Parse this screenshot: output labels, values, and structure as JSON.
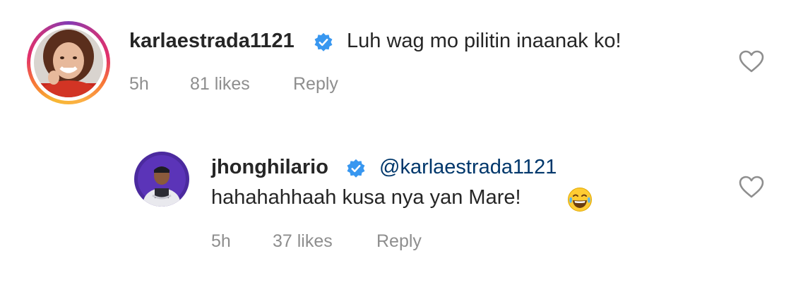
{
  "comments": [
    {
      "username": "karlaestrada1121",
      "verified": true,
      "text": "Luh wag mo pilitin inaanak ko!",
      "time": "5h",
      "likes": "81 likes",
      "reply_label": "Reply",
      "avatar_ring": true
    },
    {
      "username": "jhonghilario",
      "verified": true,
      "mention": "@karlaestrada1121",
      "text": "hahahahhaah kusa nya yan Mare!",
      "emoji": "face-with-tears-of-joy",
      "time": "5h",
      "likes": "37 likes",
      "reply_label": "Reply"
    }
  ],
  "colors": {
    "text": "#262626",
    "meta": "#8e8e8e",
    "mention": "#00376b",
    "verified": "#3897f0"
  },
  "icons": [
    "heart-outline-icon",
    "verified-badge-icon",
    "tears-of-joy-emoji"
  ]
}
